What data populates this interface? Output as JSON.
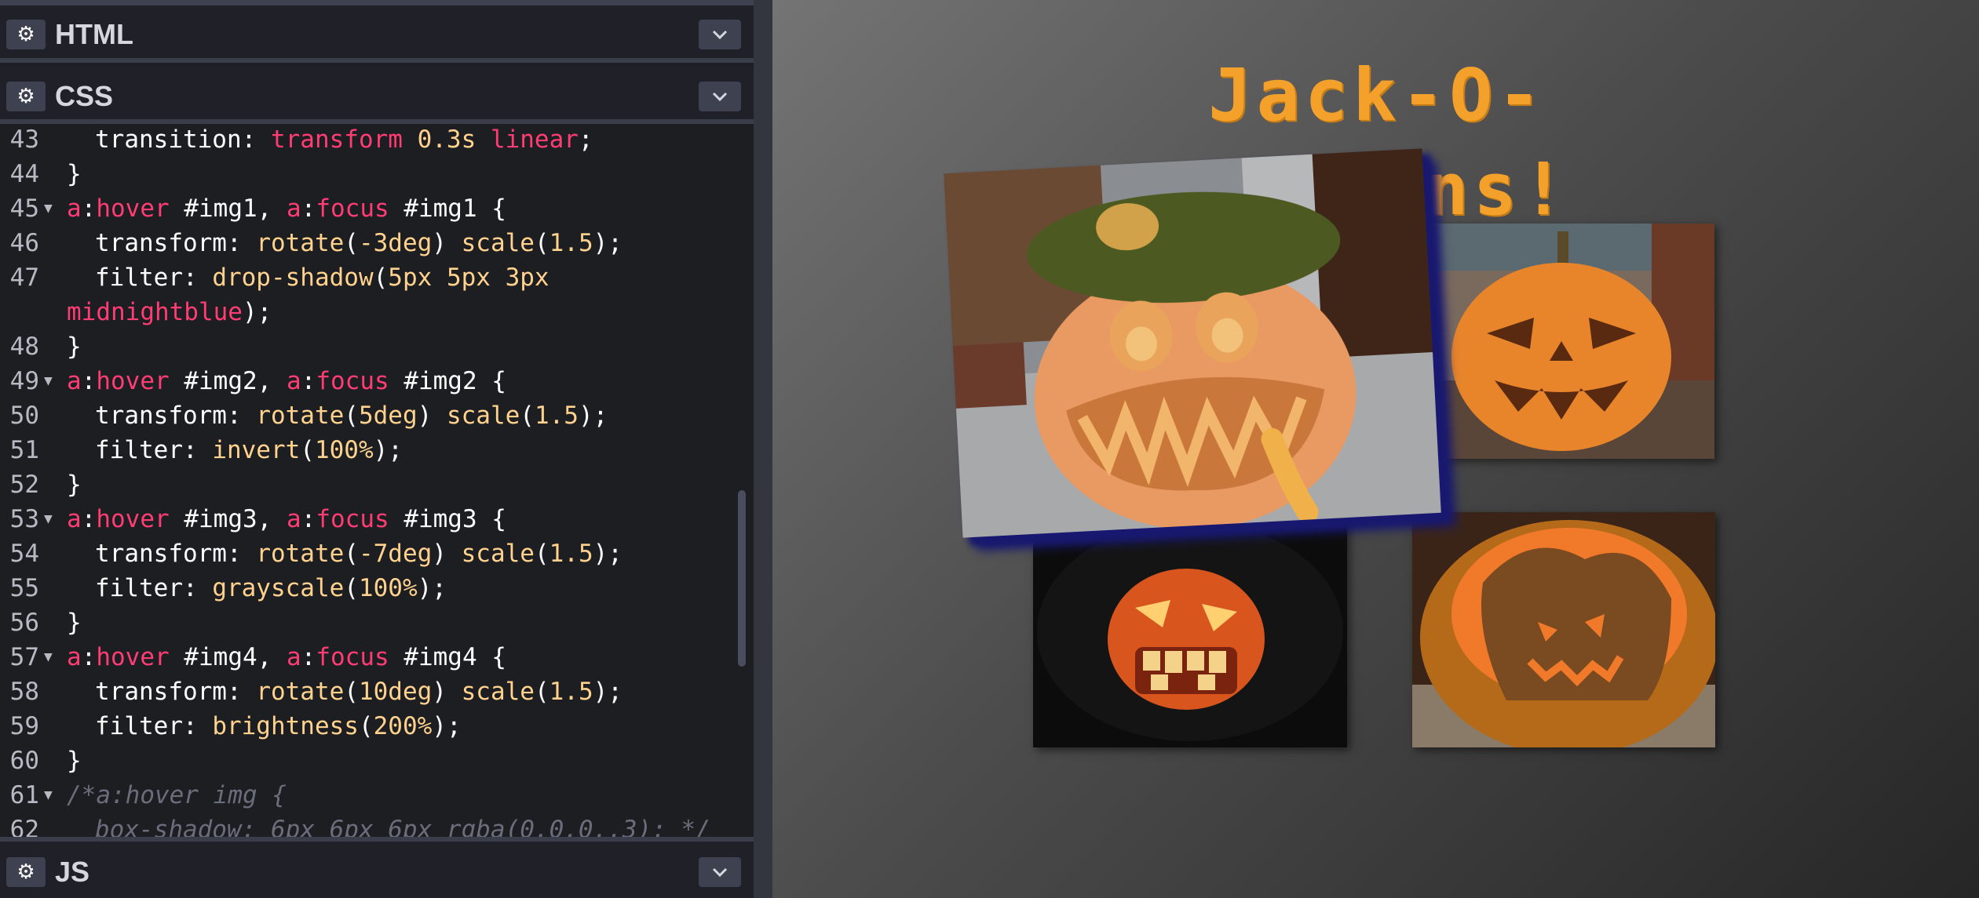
{
  "editor": {
    "panels": {
      "html": {
        "label": "HTML"
      },
      "css": {
        "label": "CSS"
      },
      "js": {
        "label": "JS"
      }
    },
    "css_lines": [
      {
        "n": "43",
        "fold": false,
        "indent": true,
        "segs": [
          [
            "pun",
            "transition: "
          ],
          [
            "kw",
            "transform "
          ],
          [
            "num",
            "0.3s "
          ],
          [
            "kw",
            "linear"
          ],
          [
            "pun",
            ";"
          ]
        ]
      },
      {
        "n": "44",
        "fold": false,
        "indent": false,
        "segs": [
          [
            "pun",
            "}"
          ]
        ]
      },
      {
        "n": "45",
        "fold": true,
        "indent": false,
        "segs": [
          [
            "sel",
            "a"
          ],
          [
            "pun",
            ":"
          ],
          [
            "sel",
            "hover"
          ],
          [
            "pun",
            " #img1, "
          ],
          [
            "sel",
            "a"
          ],
          [
            "pun",
            ":"
          ],
          [
            "sel",
            "focus"
          ],
          [
            "pun",
            " #img1 {"
          ]
        ]
      },
      {
        "n": "46",
        "fold": false,
        "indent": true,
        "segs": [
          [
            "pun",
            "transform: "
          ],
          [
            "fn",
            "rotate"
          ],
          [
            "pun",
            "("
          ],
          [
            "num",
            "-3deg"
          ],
          [
            "pun",
            ") "
          ],
          [
            "fn",
            "scale"
          ],
          [
            "pun",
            "("
          ],
          [
            "num",
            "1.5"
          ],
          [
            "pun",
            ");"
          ]
        ]
      },
      {
        "n": "47",
        "fold": false,
        "indent": true,
        "segs": [
          [
            "pun",
            "filter: "
          ],
          [
            "fn",
            "drop-shadow"
          ],
          [
            "pun",
            "("
          ],
          [
            "num",
            "5px 5px 3px"
          ]
        ]
      },
      {
        "n": "",
        "fold": false,
        "indent": false,
        "segs": [
          [
            "kw",
            "midnightblue"
          ],
          [
            "pun",
            ");"
          ]
        ]
      },
      {
        "n": "48",
        "fold": false,
        "indent": false,
        "segs": [
          [
            "pun",
            "}"
          ]
        ]
      },
      {
        "n": "49",
        "fold": true,
        "indent": false,
        "segs": [
          [
            "sel",
            "a"
          ],
          [
            "pun",
            ":"
          ],
          [
            "sel",
            "hover"
          ],
          [
            "pun",
            " #img2, "
          ],
          [
            "sel",
            "a"
          ],
          [
            "pun",
            ":"
          ],
          [
            "sel",
            "focus"
          ],
          [
            "pun",
            " #img2 {"
          ]
        ]
      },
      {
        "n": "50",
        "fold": false,
        "indent": true,
        "segs": [
          [
            "pun",
            "transform: "
          ],
          [
            "fn",
            "rotate"
          ],
          [
            "pun",
            "("
          ],
          [
            "num",
            "5deg"
          ],
          [
            "pun",
            ") "
          ],
          [
            "fn",
            "scale"
          ],
          [
            "pun",
            "("
          ],
          [
            "num",
            "1.5"
          ],
          [
            "pun",
            ");"
          ]
        ]
      },
      {
        "n": "51",
        "fold": false,
        "indent": true,
        "segs": [
          [
            "pun",
            "filter: "
          ],
          [
            "fn",
            "invert"
          ],
          [
            "pun",
            "("
          ],
          [
            "num",
            "100%"
          ],
          [
            "pun",
            ");"
          ]
        ]
      },
      {
        "n": "52",
        "fold": false,
        "indent": false,
        "segs": [
          [
            "pun",
            "}"
          ]
        ]
      },
      {
        "n": "53",
        "fold": true,
        "indent": false,
        "segs": [
          [
            "sel",
            "a"
          ],
          [
            "pun",
            ":"
          ],
          [
            "sel",
            "hover"
          ],
          [
            "pun",
            " #img3, "
          ],
          [
            "sel",
            "a"
          ],
          [
            "pun",
            ":"
          ],
          [
            "sel",
            "focus"
          ],
          [
            "pun",
            " #img3 {"
          ]
        ]
      },
      {
        "n": "54",
        "fold": false,
        "indent": true,
        "segs": [
          [
            "pun",
            "transform: "
          ],
          [
            "fn",
            "rotate"
          ],
          [
            "pun",
            "("
          ],
          [
            "num",
            "-7deg"
          ],
          [
            "pun",
            ") "
          ],
          [
            "fn",
            "scale"
          ],
          [
            "pun",
            "("
          ],
          [
            "num",
            "1.5"
          ],
          [
            "pun",
            ");"
          ]
        ]
      },
      {
        "n": "55",
        "fold": false,
        "indent": true,
        "segs": [
          [
            "pun",
            "filter: "
          ],
          [
            "fn",
            "grayscale"
          ],
          [
            "pun",
            "("
          ],
          [
            "num",
            "100%"
          ],
          [
            "pun",
            ");"
          ]
        ]
      },
      {
        "n": "56",
        "fold": false,
        "indent": false,
        "segs": [
          [
            "pun",
            "}"
          ]
        ]
      },
      {
        "n": "57",
        "fold": true,
        "indent": false,
        "segs": [
          [
            "sel",
            "a"
          ],
          [
            "pun",
            ":"
          ],
          [
            "sel",
            "hover"
          ],
          [
            "pun",
            " #img4, "
          ],
          [
            "sel",
            "a"
          ],
          [
            "pun",
            ":"
          ],
          [
            "sel",
            "focus"
          ],
          [
            "pun",
            " #img4 {"
          ]
        ]
      },
      {
        "n": "58",
        "fold": false,
        "indent": true,
        "segs": [
          [
            "pun",
            "transform: "
          ],
          [
            "fn",
            "rotate"
          ],
          [
            "pun",
            "("
          ],
          [
            "num",
            "10deg"
          ],
          [
            "pun",
            ") "
          ],
          [
            "fn",
            "scale"
          ],
          [
            "pun",
            "("
          ],
          [
            "num",
            "1.5"
          ],
          [
            "pun",
            ");"
          ]
        ]
      },
      {
        "n": "59",
        "fold": false,
        "indent": true,
        "segs": [
          [
            "pun",
            "filter: "
          ],
          [
            "fn",
            "brightness"
          ],
          [
            "pun",
            "("
          ],
          [
            "num",
            "200%"
          ],
          [
            "pun",
            ");"
          ]
        ]
      },
      {
        "n": "60",
        "fold": false,
        "indent": false,
        "segs": [
          [
            "pun",
            "}"
          ]
        ]
      },
      {
        "n": "61",
        "fold": true,
        "indent": false,
        "segs": [
          [
            "cmt",
            "/*a:hover img {"
          ]
        ]
      },
      {
        "n": "62",
        "fold": false,
        "indent": true,
        "segs": [
          [
            "cmt",
            "box-shadow: 6px 6px 6px rgba(0,0,0,.3); */"
          ]
        ]
      }
    ]
  },
  "preview": {
    "title": "Jack-O-Laterns!",
    "images": [
      {
        "id": "img1",
        "name": "pumpkin-photo-monster-moss"
      },
      {
        "id": "img2",
        "name": "pumpkin-photo-classic-face"
      },
      {
        "id": "img3",
        "name": "pumpkin-photo-dark-toothy"
      },
      {
        "id": "img4",
        "name": "pumpkin-photo-silhouette"
      }
    ]
  },
  "colors": {
    "title_orange": "#f4a12c",
    "selector_pink": "#ff3c74",
    "value_yellow": "#ffd28d",
    "shadow_midnightblue": "#191970"
  },
  "icons": {
    "panel_settings": "gear-icon",
    "panel_collapse": "chevron-down-icon"
  }
}
